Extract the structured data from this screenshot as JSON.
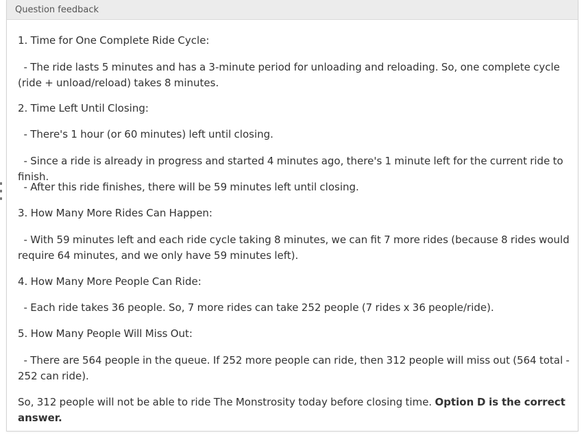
{
  "panel": {
    "title": "Question feedback"
  },
  "feedback": {
    "p1": "1. Time for One Complete Ride Cycle:",
    "p2": "  - The ride lasts 5 minutes and has a 3-minute period for unloading and reloading. So, one complete cycle (ride + unload/reload) takes 8 minutes.",
    "p3": "2. Time Left Until Closing:",
    "p4": "  - There's 1 hour (or 60 minutes) left until closing.",
    "p5": "  - Since a ride is already in progress and started 4 minutes ago, there's 1 minute left for the current ride to finish.",
    "p6": "  - After this ride finishes, there will be 59 minutes left until closing.",
    "p7": "3. How Many More Rides Can Happen:",
    "p8": "  - With 59 minutes left and each ride cycle taking 8 minutes, we can fit 7 more rides (because 8 rides would require 64 minutes, and we only have 59 minutes left).",
    "p9": "4. How Many More People Can Ride:",
    "p10": "  - Each ride takes 36 people. So, 7 more rides can take 252 people (7 rides x 36 people/ride).",
    "p11": "5. How Many People Will Miss Out:",
    "p12": "  - There are 564 people in the queue. If 252 more people can ride, then 312 people will miss out (564 total - 252 can ride).",
    "p13": "So, 312 people will not be able to ride The Monstrosity today before closing time.",
    "p13_bold": "Option D is the correct answer."
  }
}
